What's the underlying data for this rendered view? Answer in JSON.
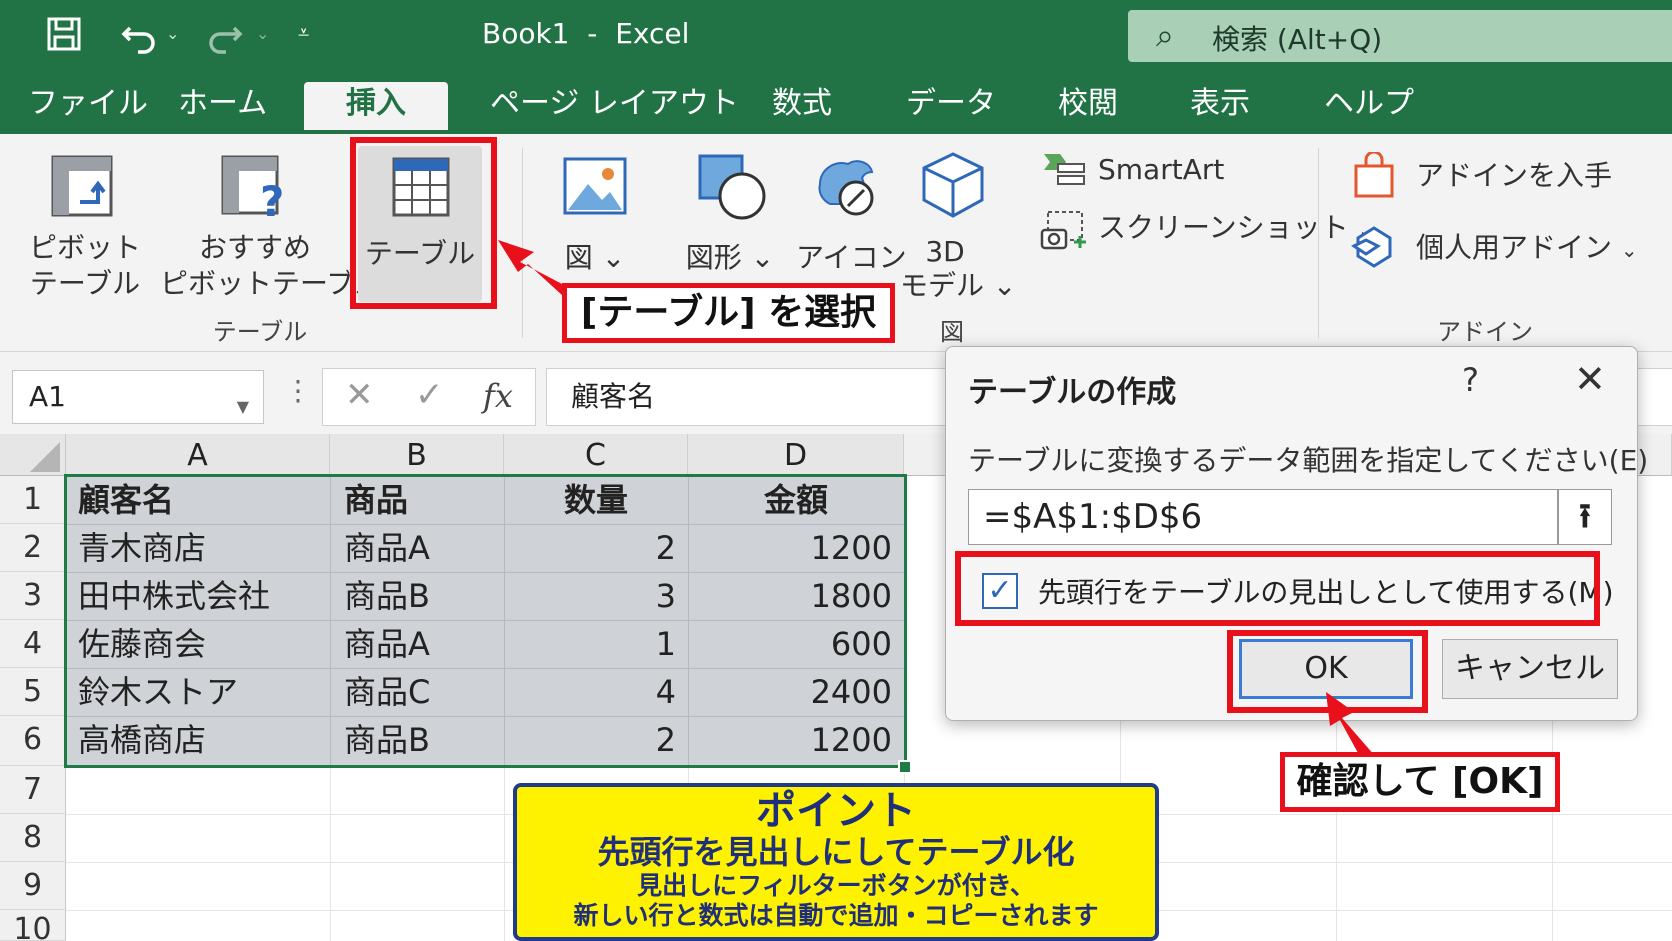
{
  "titlebar": {
    "title": "Book1  -  Excel",
    "search_placeholder": "検索 (Alt+Q)",
    "bg_color": "#217346"
  },
  "menu": {
    "tabs": [
      "ファイル",
      "ホーム",
      "挿入",
      "ページ レイアウト",
      "数式",
      "データ",
      "校閲",
      "表示",
      "ヘルプ"
    ],
    "active_tab": "挿入"
  },
  "ribbon": {
    "pivot_line1": "ピボット",
    "pivot_line2": "テーブル",
    "recommended_line1": "おすすめ",
    "recommended_line2": "ピボットテーブル",
    "table_button": "テーブル",
    "group_tables": "テーブル",
    "picture": "図",
    "shapes": "図形",
    "icons": "アイコン",
    "model3d_line1": "3D",
    "model3d_line2": "モデル",
    "smartart": "SmartArt",
    "screenshot": "スクリーンショット",
    "group_illustrations": "図",
    "get_addins": "アドインを入手",
    "my_addins": "個人用アドイン",
    "group_addins": "アドイン"
  },
  "formula_bar": {
    "name_box": "A1",
    "fx_label": "fx",
    "formula": "顧客名"
  },
  "sheet": {
    "columns": [
      "A",
      "B",
      "C",
      "D"
    ],
    "rows": [
      "1",
      "2",
      "3",
      "4",
      "5",
      "6",
      "7",
      "8",
      "9",
      "10"
    ],
    "header": [
      "顧客名",
      "商品",
      "数量",
      "金額"
    ],
    "data": [
      [
        "青木商店",
        "商品A",
        "2",
        "1200"
      ],
      [
        "田中株式会社",
        "商品B",
        "3",
        "1800"
      ],
      [
        "佐藤商会",
        "商品A",
        "1",
        "600"
      ],
      [
        "鈴木ストア",
        "商品C",
        "4",
        "2400"
      ],
      [
        "高橋商店",
        "商品B",
        "2",
        "1200"
      ]
    ]
  },
  "dialog": {
    "title": "テーブルの作成",
    "help": "?",
    "close": "✕",
    "range_label": "テーブルに変換するデータ範囲を指定してください(E)",
    "range_value": "=$A$1:$D$6",
    "checkbox_label": "先頭行をテーブルの見出しとして使用する(M)",
    "checkbox_checked": true,
    "ok": "OK",
    "cancel": "キャンセル"
  },
  "annotations": {
    "callout_select": "[テーブル] を選択",
    "callout_ok": "確認して [OK]",
    "point_title": "ポイント",
    "point_line1": "先頭行を見出しにしてテーブル化",
    "point_line2": "見出しにフィルターボタンが付き、",
    "point_line3": "新しい行と数式は自動で追加・コピーされます",
    "red": "#e8101a",
    "point_bg": "#fff200"
  }
}
